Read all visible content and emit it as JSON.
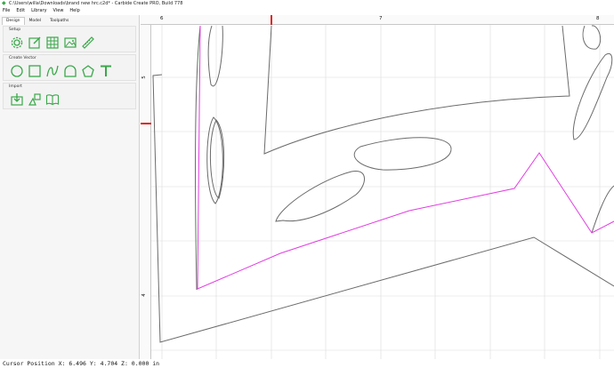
{
  "window": {
    "title": "C:\\Users\\willa\\Downloads\\brand new hrc.c2d* - Carbide Create PRO, Build 778"
  },
  "menu": [
    "File",
    "Edit",
    "Library",
    "View",
    "Help"
  ],
  "tabs": [
    {
      "label": "Design",
      "active": true
    },
    {
      "label": "Model",
      "active": false
    },
    {
      "label": "Toolpaths",
      "active": false
    }
  ],
  "sections": {
    "setup": {
      "label": "Setup",
      "icons": [
        "gear-icon",
        "edit-icon",
        "grid-icon",
        "image-icon",
        "ruler-icon"
      ]
    },
    "create_vector": {
      "label": "Create Vector",
      "icons": [
        "circle-icon",
        "rectangle-icon",
        "curve-icon",
        "arch-icon",
        "polygon-icon",
        "text-icon"
      ]
    },
    "import": {
      "label": "Import",
      "icons": [
        "import-icon",
        "shapes-icon",
        "book-icon"
      ]
    }
  },
  "rulers": {
    "top_labels": [
      "6",
      "7",
      "8"
    ],
    "left_labels": [
      "5",
      "4"
    ]
  },
  "status": {
    "cursor": "Cursor Position X: 6.496 Y: 4.704 Z: 0.000 in"
  },
  "colors": {
    "icon_green": "#3aa84a",
    "toolpath_magenta": "#e23de2",
    "marker_red": "#e02020",
    "vector_gray": "#6b6b6b"
  }
}
